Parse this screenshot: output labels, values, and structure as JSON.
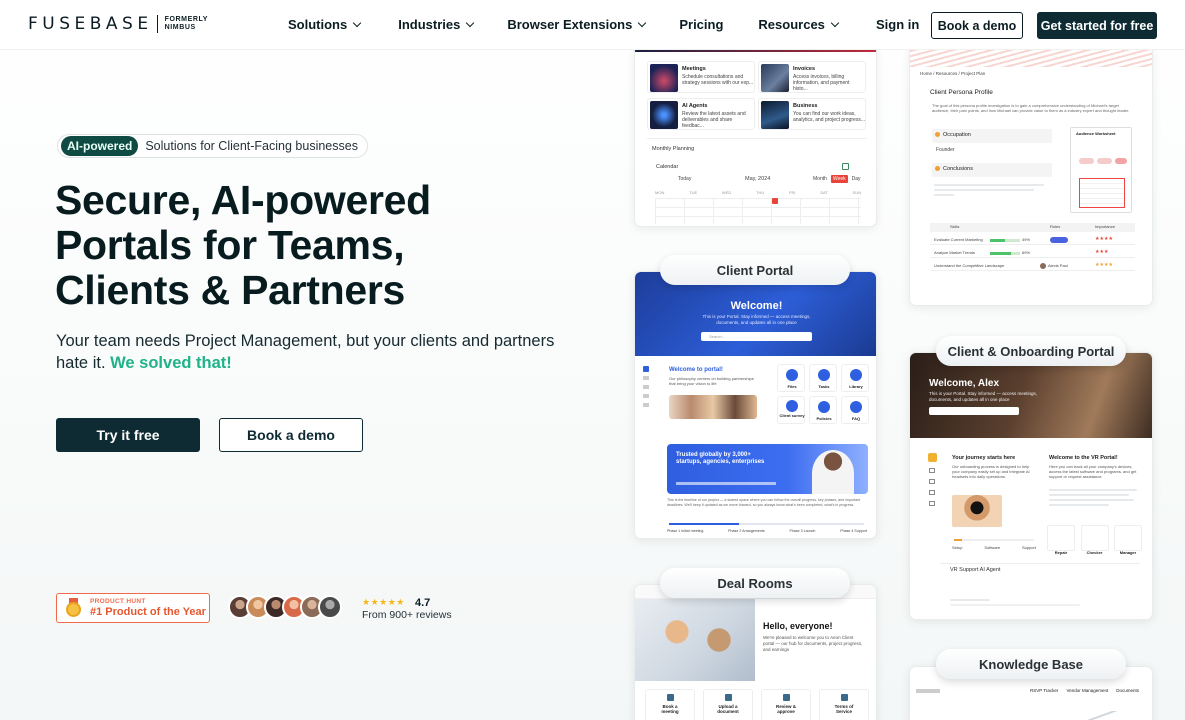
{
  "nav": {
    "logo_word": "FUSEBASE",
    "logo_formerly": "FORMERLY NIMBUS",
    "menu": [
      {
        "label": "Solutions",
        "dropdown": true
      },
      {
        "label": "Industries",
        "dropdown": true
      },
      {
        "label": "Browser Extensions",
        "dropdown": true
      },
      {
        "label": "Pricing",
        "dropdown": false
      },
      {
        "label": "Resources",
        "dropdown": true
      }
    ],
    "signin": "Sign in",
    "book_demo": "Book a demo",
    "get_started": "Get started for free"
  },
  "hero": {
    "badge_pill": "AI-powered",
    "badge_text": "Solutions for Client-Facing businesses",
    "headline": [
      "Secure, AI-powered",
      "Portals for Teams,",
      "Clients & Partners"
    ],
    "subtitle": "Your team needs Project Management, but your clients and partners hate it.",
    "subtitle_accent": "We solved that!",
    "try_button": "Try it free",
    "demo_button": "Book a demo"
  },
  "social": {
    "ph_small": "PRODUCT HUNT",
    "ph_big": "#1 Product of the Year",
    "stars": "★★★★★",
    "rating": "4.7",
    "reviews": "From 900+ reviews",
    "avatar_colors": [
      "#5a3e36",
      "#c98b5a",
      "#3b2a25",
      "#d86a4a",
      "#8a6a58",
      "#4a4a4a"
    ]
  },
  "cards": {
    "portal_label": "Client Portal",
    "onboarding_label": "Client & Onboarding Portal",
    "deal_label": "Deal Rooms",
    "knowledge_label": "Knowledge Base",
    "top_left": {
      "tiles": [
        {
          "title": "Meetings",
          "desc": "Schedule consultations and strategy sessions with our exp..."
        },
        {
          "title": "Invoices",
          "desc": "Access invoices, billing information, and payment histo..."
        },
        {
          "title": "AI Agents",
          "desc": "Review the latest assets and deliverables and share feedbac..."
        },
        {
          "title": "Business",
          "desc": "You can find our work ideas, analytics, and project progress..."
        }
      ],
      "planning": "Monthly Planning",
      "calendar": "Calendar",
      "today": "Today",
      "month": "May, 2024",
      "views": [
        "Month",
        "Week",
        "Day"
      ],
      "days": [
        "MON",
        "TUE",
        "WED",
        "THU",
        "FRI",
        "SAT",
        "SUN"
      ]
    },
    "top_right": {
      "crumb": "Home / Resources / Project Plan",
      "title": "Client Persona Profile",
      "intro": "The goal of this persona profile investigation is to gain a comprehensive understanding of Michael's target audience, their pain points, and how Michael can provide value to them as a industry expert and thought leader.",
      "occupation": "Occupation",
      "founder": "Founder",
      "conclusions": "Conclusions",
      "worksheet": "Audience Worksheet",
      "skills_head": [
        "Skills",
        "Roles",
        "Importance"
      ],
      "skills": [
        "Evaluate Current Marketing",
        "Analyze Market Trends",
        "Understand the Competitive Landscape"
      ],
      "pcts": [
        "49%",
        "69%"
      ],
      "person": "Alexis Paul"
    },
    "portal": {
      "welcome": "Welcome!",
      "welcome_sub": "This is your Portal. Stay informed — access meetings, documents, and updates all in one place",
      "search": "Search...",
      "portal_title": "Welcome to portal!",
      "portal_desc": "Our philosophy centers on building partnerships that bring your vision to life",
      "icons": [
        "Files",
        "Tasks",
        "Library",
        "Client survey",
        "Policies",
        "FAQ"
      ],
      "trusted": "Trusted globally by 3,000+ startups, agencies, enterprises",
      "timeline": "This is the timeline of our project — a shared space where you can follow the overall progress, key phases, and important deadlines. We'll keep it updated as we move forward, so you always know what's been completed, what's in progress.",
      "phases": [
        "Phase 1 Initial meeting",
        "Phase 2 Arrangements",
        "Phase 3 Launch",
        "Phase 4 Support"
      ]
    },
    "onboarding": {
      "welcome": "Welcome, Alex",
      "welcome_sub": "This is your Portal. Stay informed — access meetings, documents, and updates all in one place",
      "journey": "Your journey starts here",
      "journey_desc": "Our onboarding process is designed to help your company easily set up and integrate AI headsets into daily operations.",
      "vr_title": "Welcome to the VR Portal!",
      "vr_desc": "Here you can track all your company's devices, access the latest software and programs, and get support or request assistance.",
      "steps": [
        "Setup",
        "Software",
        "Support"
      ],
      "tabs": [
        "Repair",
        "Checker",
        "Manager"
      ],
      "agent": "VR Support AI Agent"
    },
    "deal": {
      "hello": "Hello, everyone!",
      "hello_desc": "We're pleased to welcome you to Aeon Client portal — our hub for documents, project progress, and earnings",
      "actions": [
        "Book a meeting",
        "Upload a document",
        "Review & approve",
        "Terms of Service"
      ]
    },
    "knowledge": {
      "nav": [
        "RSVP Tracker",
        "Vendor Management",
        "Documents"
      ]
    }
  }
}
